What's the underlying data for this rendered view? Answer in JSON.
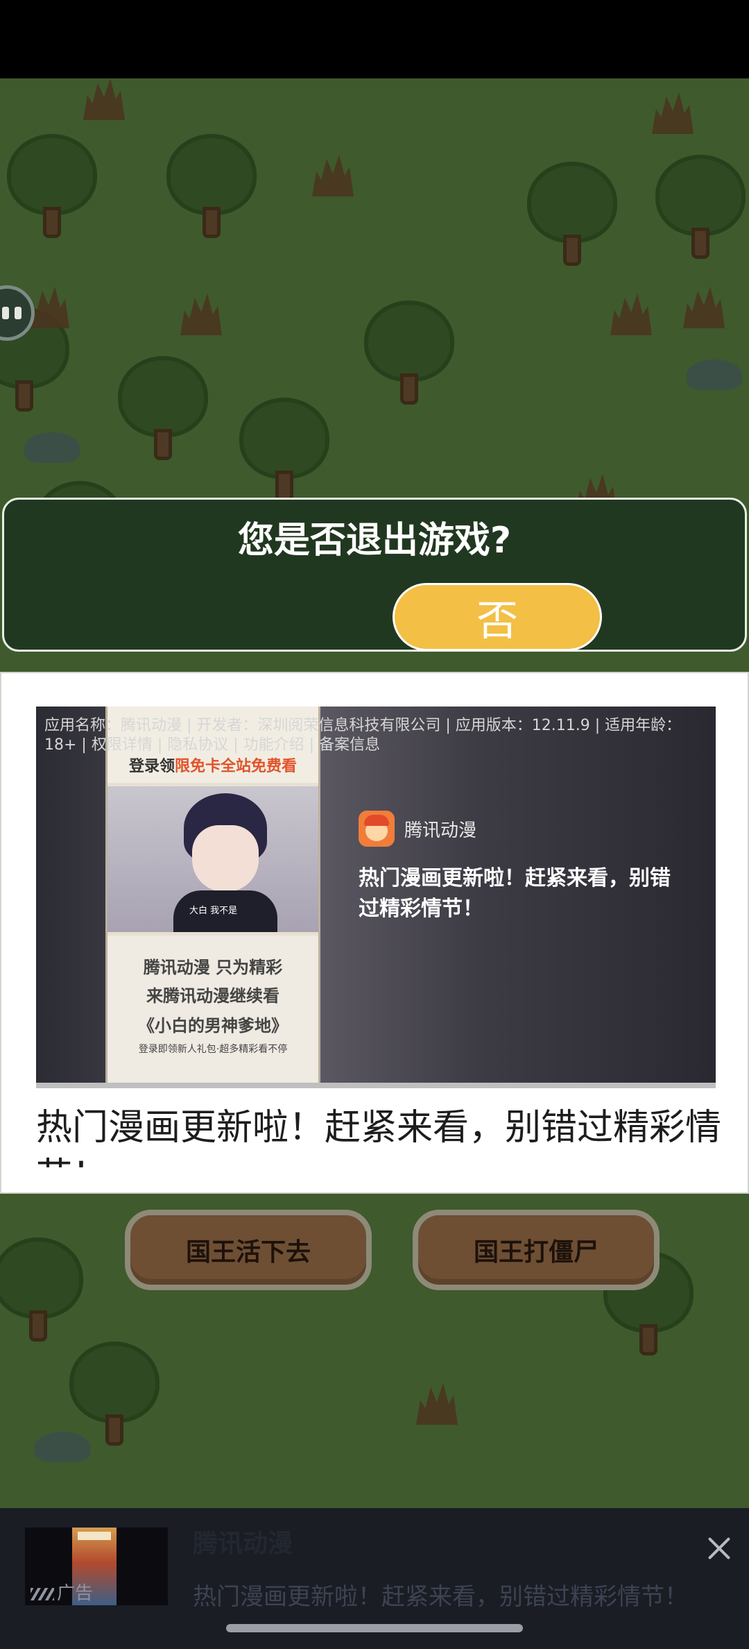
{
  "exit_dialog": {
    "title": "您是否退出游戏?",
    "no_label": "否"
  },
  "game_menu": {
    "buttons": [
      "国王活下去",
      "国王打僵尸"
    ]
  },
  "ad_card": {
    "info": "应用名称：腾讯动漫 | 开发者：深圳阅荣信息科技有限公司 | 应用版本：12.11.9 | 适用年龄：18+ | 权限详情 | 隐私协议 | 功能介绍 | 备案信息",
    "comic": {
      "top_text_prefix": "登录领",
      "top_text_highlight": "限免卡全站免费看",
      "art_caption": "大白  我不是",
      "line1": "腾讯动漫 只为精彩",
      "line2": "来腾讯动漫继续看",
      "line3": "《小白的男神爹地》",
      "line4": "登录即领新人礼包·超多精彩看不停"
    },
    "app_name": "腾讯动漫",
    "description": "热门漫画更新啦！赶紧来看，别错过精彩情节！",
    "headline": "热门漫画更新啦！赶紧来看，别错过精彩情节！"
  },
  "bottom_banner": {
    "ad_label": "广告",
    "title": "腾讯动漫",
    "description": "热门漫画更新啦！赶紧来看，别错过精彩情节！"
  },
  "colors": {
    "dialog_bg": "#213820",
    "no_button": "#f3bf45",
    "game_grass": "#3f5a2c",
    "comic_highlight": "#e2532a"
  }
}
